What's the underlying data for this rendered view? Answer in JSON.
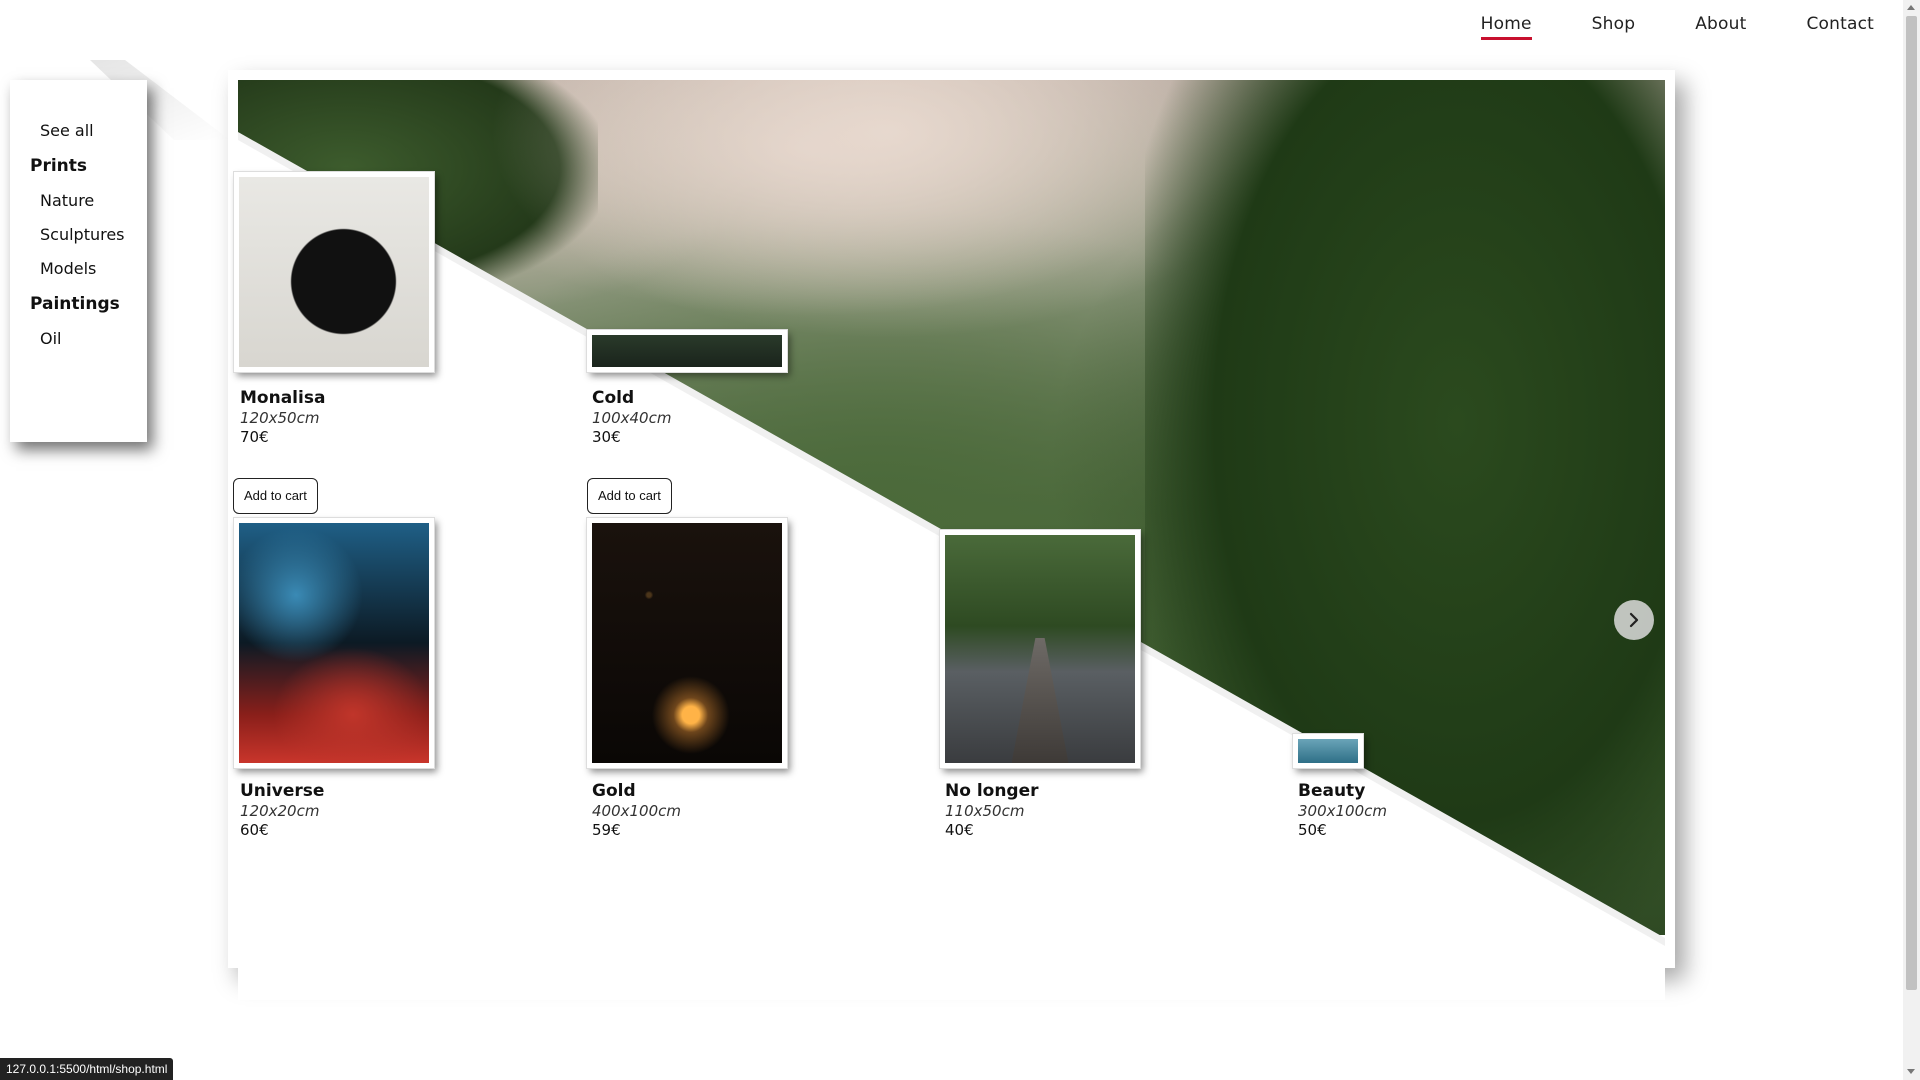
{
  "nav": {
    "items": [
      {
        "label": "Home",
        "active": true
      },
      {
        "label": "Shop",
        "active": false
      },
      {
        "label": "About",
        "active": false
      },
      {
        "label": "Contact",
        "active": false
      }
    ],
    "accent_color": "#c8102e"
  },
  "sidebar": {
    "see_all": "See all",
    "categories": [
      {
        "label": "Prints",
        "items": [
          "Nature",
          "Sculptures",
          "Models"
        ]
      },
      {
        "label": "Paintings",
        "items": [
          "Oil"
        ]
      }
    ]
  },
  "products": [
    {
      "title": "Monalisa",
      "size": "120x50cm",
      "price": "70€",
      "cart": "Add to cart"
    },
    {
      "title": "Cold",
      "size": "100x40cm",
      "price": "30€",
      "cart": "Add to cart"
    },
    {
      "title": "Universe",
      "size": "120x20cm",
      "price": "60€"
    },
    {
      "title": "Gold",
      "size": "400x100cm",
      "price": "59€"
    },
    {
      "title": "No longer",
      "size": "110x50cm",
      "price": "40€"
    },
    {
      "title": "Beauty",
      "size": "300x100cm",
      "price": "50€"
    }
  ],
  "carousel": {
    "next_icon": "chevron-right-icon"
  },
  "statusbar": {
    "url": "127.0.0.1:5500/html/shop.html"
  }
}
